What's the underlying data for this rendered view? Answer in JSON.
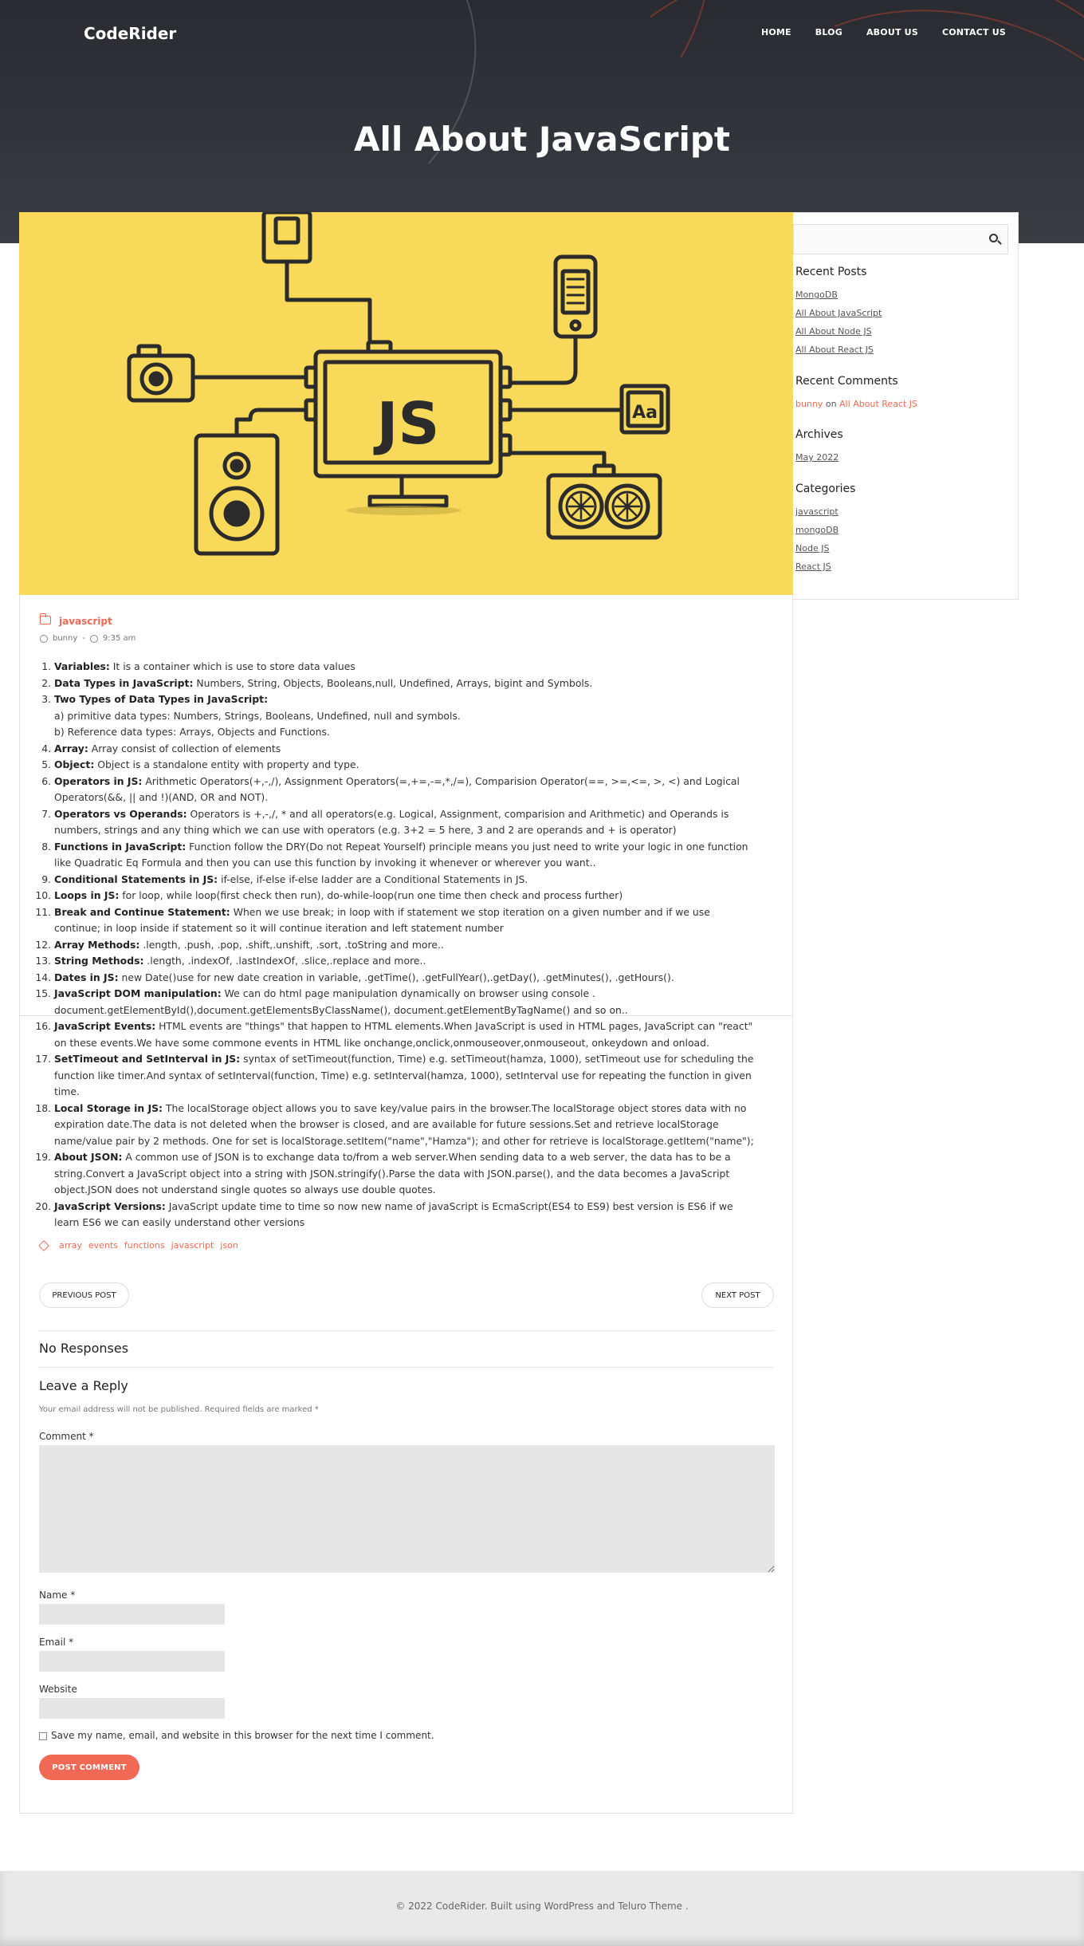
{
  "header": {
    "brand": "CodeRider",
    "nav": [
      "HOME",
      "BLOG",
      "ABOUT US",
      "CONTACT US"
    ],
    "title": "All About JavaScript"
  },
  "feature_image": {
    "text": "JS",
    "text2": "Aa",
    "bg": "#f8d95a"
  },
  "sidebar": {
    "search_placeholder": "",
    "recent_posts_title": "Recent Posts",
    "recent_posts": [
      "MongoDB",
      "All About JavaScript",
      "All About Node JS",
      "All About React JS"
    ],
    "recent_comments_title": "Recent Comments",
    "comment_author": "bunny",
    "comment_on": "on",
    "comment_post": "All About React JS",
    "archives_title": "Archives",
    "archives": [
      "May 2022"
    ],
    "categories_title": "Categories",
    "categories": [
      "javascript",
      "mongoDB",
      "Node JS",
      "React JS"
    ]
  },
  "post": {
    "category": "javascript",
    "author": "bunny",
    "time": "9:35 am",
    "points": [
      {
        "term": "Variables:",
        "text": " It is a container which is use to store data values"
      },
      {
        "term": "Data Types in JavaScript:",
        "text": " Numbers, String, Objects, Booleans,null, Undefined, Arrays, bigint and Symbols."
      },
      {
        "term": "Two Types of Data Types in JavaScript:",
        "text": "\na) primitive data types: Numbers, Strings, Booleans, Undefined, null and symbols.\nb) Reference data types: Arrays, Objects and Functions."
      },
      {
        "term": "Array:",
        "text": " Array consist of collection of elements"
      },
      {
        "term": "Object:",
        "text": " Object is a standalone entity with property and type."
      },
      {
        "term": "Operators in JS:",
        "text": " Arithmetic Operators(+,-,/), Assignment Operators(=,+=,-=,*,/=), Comparision Operator(==, >=,<=, >, <) and Logical Operators(&&, || and !)(AND, OR and NOT)."
      },
      {
        "term": "Operators vs Operands:",
        "text": " Operators is +,-,/, * and all operators(e.g. Logical, Assignment, comparision and Arithmetic) and Operands is numbers, strings and any thing which we can use with operators (e.g. 3+2 = 5 here, 3 and 2 are operands and + is operator)"
      },
      {
        "term": "Functions in JavaScript:",
        "text": " Function follow the DRY(Do not Repeat Yourself) principle means you just need to write your logic in one function like Quadratic Eq Formula and then you can use this function by invoking it whenever or wherever you want.."
      },
      {
        "term": "Conditional Statements in JS:",
        "text": " if-else, if-else if-else ladder are a Conditional Statements in JS."
      },
      {
        "term": "Loops in JS:",
        "text": " for loop, while loop(first check then run), do-while-loop(run one time then check and process further)"
      },
      {
        "term": "Break and Continue Statement:",
        "text": " When we use break; in loop with if statement we stop iteration on a given number and if we use continue; in loop inside if statement so it will continue iteration and left statement number"
      },
      {
        "term": "Array Methods:",
        "text": " .length, .push, .pop, .shift,.unshift, .sort, .toString and more.."
      },
      {
        "term": "String Methods:",
        "text": " .length, .indexOf, .lastIndexOf, .slice,.replace and more.."
      },
      {
        "term": "Dates in JS:",
        "text": " new Date()use for new date creation in variable, .getTime(), .getFullYear(),.getDay(), .getMinutes(), .getHours()."
      },
      {
        "term": "JavaScript DOM manipulation:",
        "text": " We can do html page manipulation dynamically on browser using console . document.getElementById(),document.getElementsByClassName(), document.getElementByTagName() and so on.."
      },
      {
        "term": "JavaScript Events:",
        "text": " HTML events are \"things\" that happen to HTML elements.When JavaScript is used in HTML pages, JavaScript can \"react\" on these events.We have some commone events in HTML like onchange,onclick,onmouseover,onmouseout, onkeydown and onload."
      },
      {
        "term": "SetTimeout and SetInterval in JS:",
        "text": " syntax of setTimeout(function, Time) e.g. setTimeout(hamza, 1000), setTimeout use for scheduling the function like timer.And syntax of setInterval(function, Time) e.g. setInterval(hamza, 1000), setInterval use for repeating the function in given time."
      },
      {
        "term": "Local Storage in JS:",
        "text": " The localStorage object allows you to save key/value pairs in the browser.The localStorage object stores data with no expiration date.The data is not deleted when the browser is closed, and are available for future sessions.Set and retrieve localStorage name/value pair by 2 methods. One for set is localStorage.setItem(\"name\",\"Hamza\"); and other for retrieve is localStorage.getItem(\"name\");"
      },
      {
        "term": "About JSON:",
        "text": " A common use of JSON is to exchange data to/from a web server.When sending data to a web server, the data has to be a string.Convert a JavaScript object into a string with JSON.stringify().Parse the data with JSON.parse(), and the data becomes a JavaScript object.JSON does not understand single quotes so always use double quotes."
      },
      {
        "term": "JavaScript Versions:",
        "text": " JavaScript update time to time so now new name of javaScript is EcmaScript(ES4 to ES9) best version is ES6 if we learn ES6 we can easily understand other versions"
      }
    ],
    "tags": [
      "array",
      "events",
      "functions",
      "javascript",
      "json"
    ],
    "prev_label": "PREVIOUS POST",
    "next_label": "NEXT POST"
  },
  "comments": {
    "responses_title": "No Responses",
    "reply_title": "Leave a Reply",
    "notice": "Your email address will not be published. Required fields are marked *",
    "comment_label": "Comment *",
    "name_label": "Name *",
    "email_label": "Email *",
    "website_label": "Website",
    "save_label": "Save my name, email, and website in this browser for the next time I comment.",
    "submit_label": "POST COMMENT"
  },
  "footer": {
    "text": "© 2022 CodeRider. Built using WordPress and Teluro Theme ."
  },
  "colors": {
    "accent": "#f16854",
    "feature_bg": "#f8d95a",
    "hero_bg": "#2f3037"
  }
}
